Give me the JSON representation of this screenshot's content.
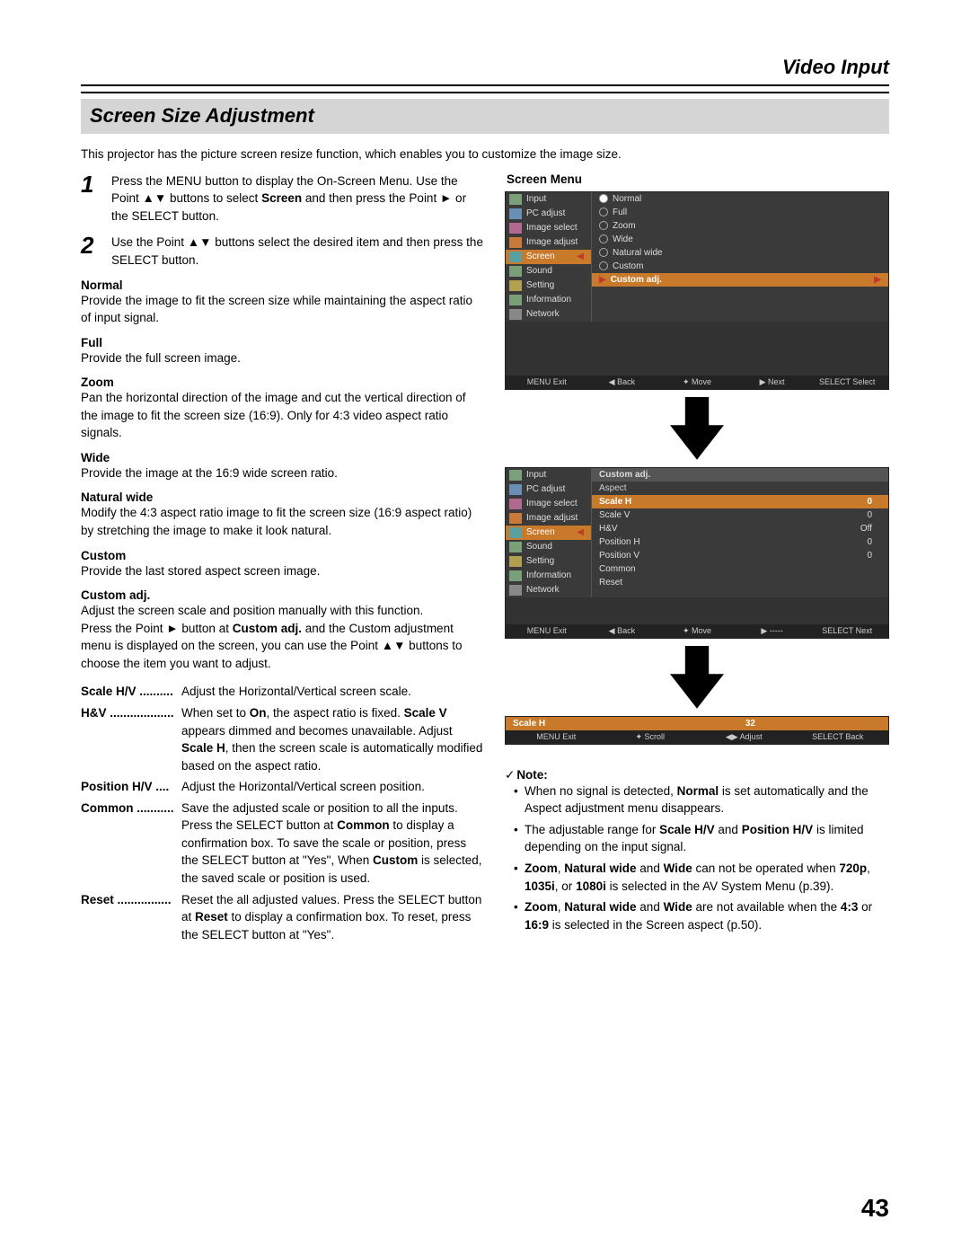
{
  "header": {
    "title": "Video Input"
  },
  "section": {
    "title": "Screen Size Adjustment"
  },
  "intro": "This projector has the picture screen resize function, which enables you to customize the image size.",
  "steps": [
    {
      "n": "1",
      "html": "Press the MENU button to display the On-Screen Menu. Use the Point ▲▼ buttons to select <b>Screen</b> and then press the Point ► or the SELECT button."
    },
    {
      "n": "2",
      "html": "Use the Point ▲▼ buttons select the desired item and then press the SELECT button."
    }
  ],
  "modes": [
    {
      "h": "Normal",
      "d": "Provide the image to fit the screen size while maintaining the aspect ratio of input signal."
    },
    {
      "h": "Full",
      "d": "Provide the full screen image."
    },
    {
      "h": "Zoom",
      "d": "Pan the horizontal direction of the image and cut the vertical direction of the image to fit the screen size (16:9). Only for 4:3 video aspect ratio signals."
    },
    {
      "h": "Wide",
      "d": "Provide the image at the 16:9 wide screen ratio."
    },
    {
      "h": "Natural wide",
      "d": "Modify the 4:3 aspect ratio image to fit the screen size (16:9 aspect ratio) by stretching the image to make it look natural."
    },
    {
      "h": "Custom",
      "d": "Provide the last stored aspect screen image."
    },
    {
      "h": "Custom adj.",
      "d": "Adjust the screen scale and position manually with this function.<br>Press the Point ► button at <b>Custom adj.</b> and the Custom adjustment menu is displayed on the screen, you can use the Point ▲▼ buttons to choose the item you want to adjust."
    }
  ],
  "defs": [
    {
      "k": "Scale H/V",
      "dots": " .......... ",
      "d": "Adjust the Horizontal/Vertical screen scale."
    },
    {
      "k": "H&V",
      "dots": " ................... ",
      "d": "When set to <b>On</b>, the aspect ratio is fixed. <b>Scale V</b> appears dimmed and becomes unavailable. Adjust <b>Scale H</b>, then the screen scale is automatically modified based on the aspect ratio."
    },
    {
      "k": "Position H/V",
      "dots": " .... ",
      "d": "Adjust the Horizontal/Vertical screen position."
    },
    {
      "k": "Common",
      "dots": " ........... ",
      "d": "Save the adjusted scale or position to all the inputs. Press the SELECT button at <b>Common</b> to display a confirmation box. To save the scale or position, press the SELECT button at \"Yes\", When <b>Custom</b> is selected, the saved scale or position is used."
    },
    {
      "k": "Reset",
      "dots": " ................ ",
      "d": "Reset the all adjusted values. Press the SELECT button at <b>Reset</b> to display a confirmation box. To reset, press the SELECT button at \"Yes\"."
    }
  ],
  "right": {
    "header": "Screen Menu",
    "menu": [
      "Input",
      "PC adjust",
      "Image select",
      "Image adjust",
      "Screen",
      "Sound",
      "Setting",
      "Information",
      "Network"
    ],
    "panel1_options": [
      {
        "l": "Normal",
        "sel": true
      },
      {
        "l": "Full"
      },
      {
        "l": "Zoom"
      },
      {
        "l": "Wide"
      },
      {
        "l": "Natural wide"
      },
      {
        "l": "Custom"
      }
    ],
    "panel1_hl": "Custom adj.",
    "panel2_header": "Custom adj.",
    "panel2_sub": "Aspect",
    "panel2_rows": [
      {
        "l": "Scale H",
        "v": "0",
        "hl": true
      },
      {
        "l": "Scale V",
        "v": "0"
      },
      {
        "l": "H&V",
        "v": "Off"
      },
      {
        "l": "Position H",
        "v": "0"
      },
      {
        "l": "Position V",
        "v": "0"
      },
      {
        "l": "Common",
        "v": ""
      },
      {
        "l": "Reset",
        "v": ""
      }
    ],
    "bar1": {
      "a": "MENU Exit",
      "b": "◀ Back",
      "c": "✦ Move",
      "d": "▶ Next",
      "e": "SELECT Select"
    },
    "bar2": {
      "a": "MENU Exit",
      "b": "◀ Back",
      "c": "✦ Move",
      "d": "▶ -----",
      "e": "SELECT Next"
    },
    "mini": {
      "title": "Scale H",
      "value": "32",
      "bar": {
        "a": "MENU Exit",
        "b": "✦ Scroll",
        "c": "◀▶ Adjust",
        "d": "SELECT Back"
      }
    }
  },
  "noteHeader": "Note:",
  "notes": [
    "When no signal is detected, <b>Normal</b> is set automatically and the Aspect adjustment menu disappears.",
    "The adjustable range for <b>Scale H/V</b> and <b>Position H/V</b> is limited depending on the input signal.",
    "<b>Zoom</b>, <b>Natural wide</b> and <b>Wide</b> can not be operated when <b>720p</b>, <b>1035i</b>, or <b>1080i</b> is selected in the AV System Menu (p.39).",
    "<b>Zoom</b>, <b>Natural wide</b> and <b>Wide</b> are not available when the <b>4:3</b> or <b>16:9</b> is selected in the Screen aspect (p.50)."
  ],
  "pageNumber": "43"
}
